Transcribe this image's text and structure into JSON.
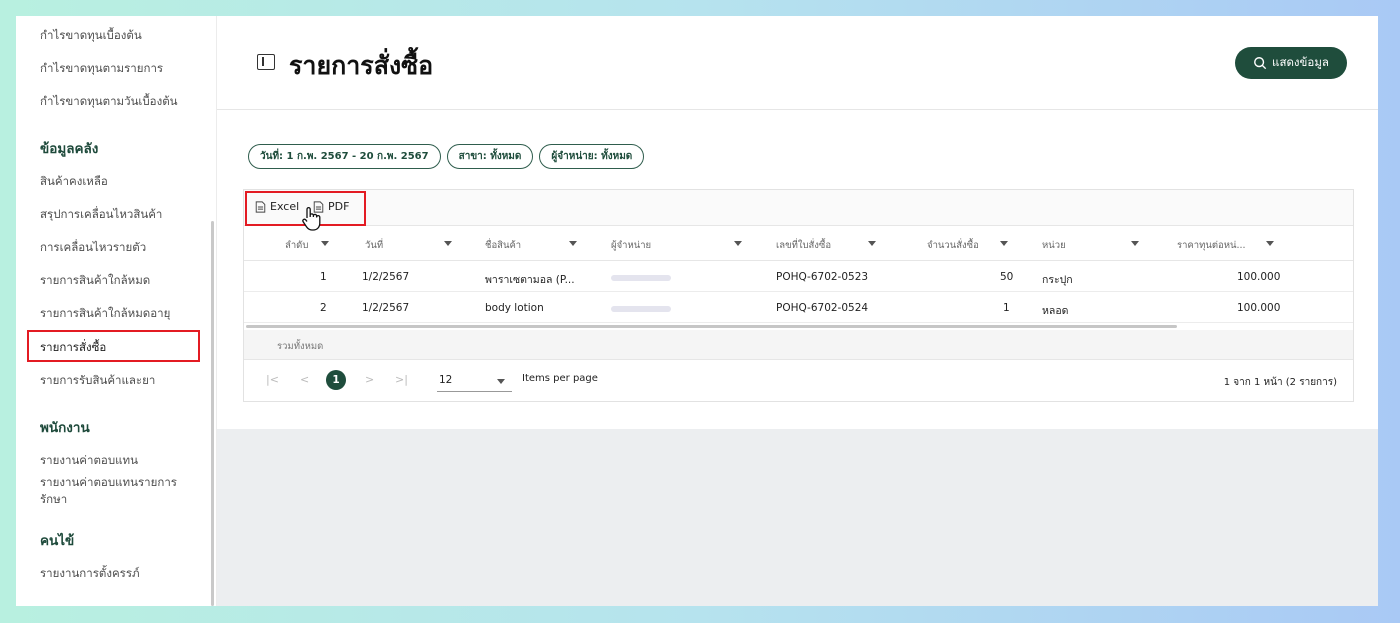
{
  "sidebar": {
    "top_items": [
      "กำไรขาดทุนเบื้องต้น",
      "กำไรขาดทุนตามรายการ",
      "กำไรขาดทุนตามวันเบื้องต้น"
    ],
    "sections": [
      {
        "title": "ข้อมูลคลัง",
        "items": [
          "สินค้าคงเหลือ",
          "สรุปการเคลื่อนไหวสินค้า",
          "การเคลื่อนไหวรายตัว",
          "รายการสินค้าใกล้หมด",
          "รายการสินค้าใกล้หมดอายุ",
          "รายการสั่งซื้อ",
          "รายการรับสินค้าและยา"
        ]
      },
      {
        "title": "พนักงาน",
        "items": [
          "รายงานค่าตอบแทน",
          "รายงานค่าตอบแทนรายการรักษา"
        ]
      },
      {
        "title": "คนไข้",
        "items": [
          "รายงานการตั้งครรภ์"
        ]
      }
    ],
    "active_item": "รายการสั่งซื้อ"
  },
  "header": {
    "title": "รายการสั่งซื้อ",
    "show_button": "แสดงข้อมูล"
  },
  "filters": [
    "วันที่: 1 ก.พ. 2567 - 20 ก.พ. 2567",
    "สาขา: ทั้งหมด",
    "ผู้จำหน่าย: ทั้งหมด"
  ],
  "export": {
    "excel": "Excel",
    "pdf": "PDF"
  },
  "table": {
    "columns": [
      "ลำดับ",
      "วันที่",
      "ชื่อสินค้า",
      "ผู้จำหน่าย",
      "เลขที่ใบสั่งซื้อ",
      "จำนวนสั่งซื้อ",
      "หน่วย",
      "ราคาทุนต่อหน่..."
    ],
    "rows": [
      {
        "no": "1",
        "date": "1/2/2567",
        "product": "พาราเซตามอล (P...",
        "po": "POHQ-6702-0523",
        "qty": "50",
        "unit": "กระปุก",
        "price": "100.000"
      },
      {
        "no": "2",
        "date": "1/2/2567",
        "product": "body lotion",
        "po": "POHQ-6702-0524",
        "qty": "1",
        "unit": "หลอด",
        "price": "100.000"
      }
    ],
    "total_label": "รวมทั้งหมด"
  },
  "pagination": {
    "current_page": "1",
    "per_page": "12",
    "per_page_label": "Items per page",
    "range_text": "1 จาก 1 หน้า (2 รายการ)"
  },
  "colors": {
    "primary": "#1f4d3c",
    "highlight": "#e31b23"
  },
  "icons": {
    "title": "sidebar-panel-icon",
    "show_button": "search-icon",
    "export": "file-icon",
    "cursor": "hand-pointer-icon",
    "sort": "caret-down-icon"
  }
}
